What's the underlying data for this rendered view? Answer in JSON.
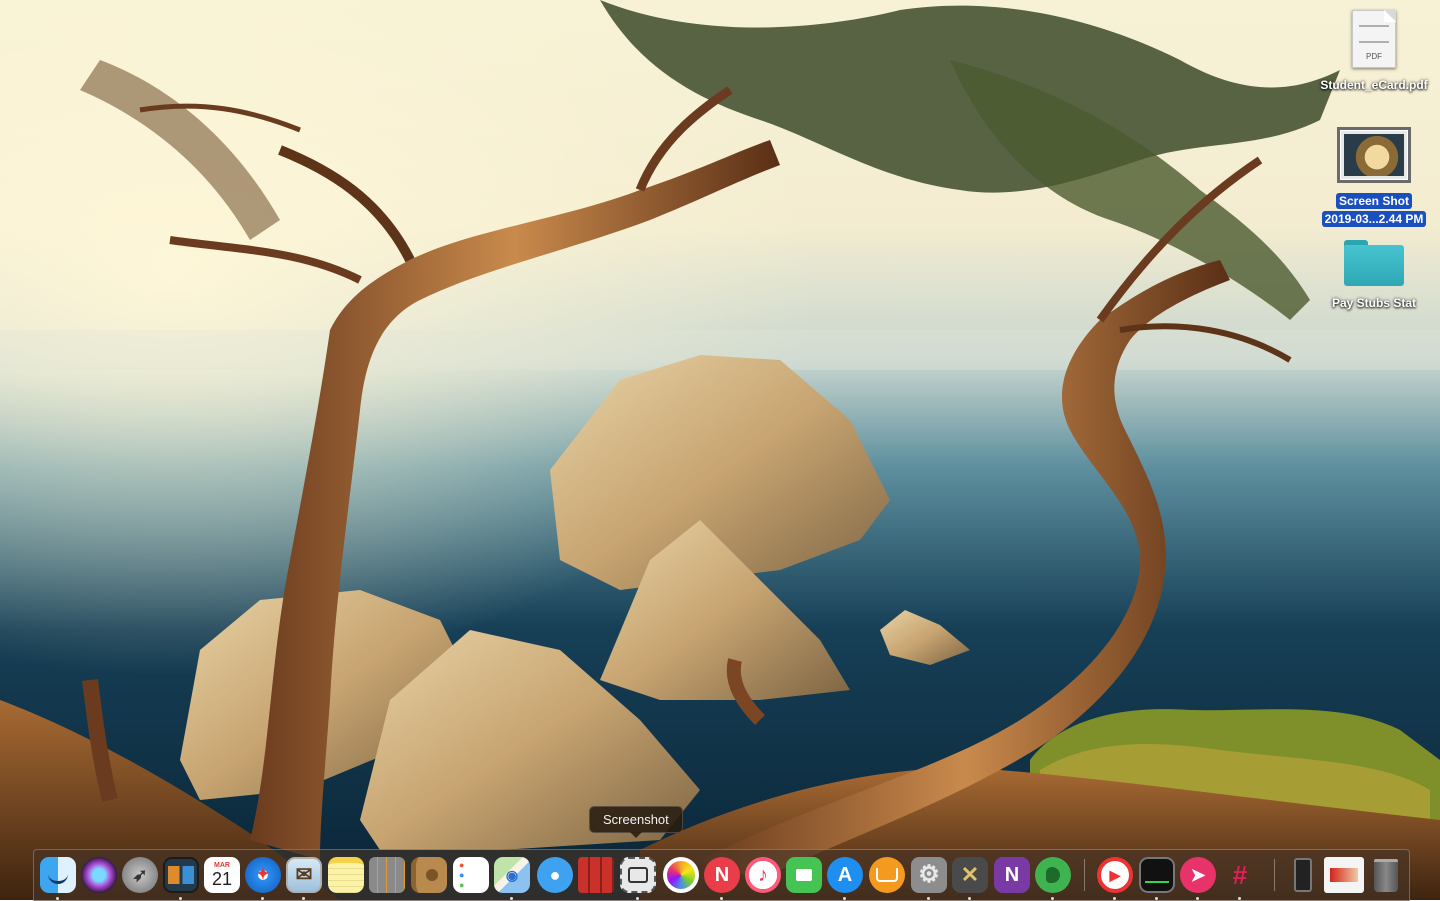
{
  "desktop": {
    "items": [
      {
        "label": "Student_eCard.pdf",
        "icon": "pdf-document-icon",
        "doc_tag": "PDF"
      },
      {
        "label_line1": "Screen Shot",
        "label_line2": "2019-03...2.44 PM",
        "icon": "screenshot-image-icon",
        "selected": true
      },
      {
        "label": "Pay Stubs Stat",
        "icon": "folder-icon"
      }
    ]
  },
  "tooltip": "Screenshot",
  "dock": {
    "apps": [
      {
        "name": "Finder",
        "glyph": ""
      },
      {
        "name": "Siri",
        "glyph": ""
      },
      {
        "name": "Launchpad",
        "glyph": "🚀"
      },
      {
        "name": "Mission Control",
        "glyph": ""
      },
      {
        "name": "Calendar",
        "month": "MAR",
        "day": "21"
      },
      {
        "name": "Safari",
        "glyph": "✦"
      },
      {
        "name": "Mail",
        "glyph": "✉"
      },
      {
        "name": "Notes",
        "glyph": ""
      },
      {
        "name": "Calculator",
        "glyph": ""
      },
      {
        "name": "Contacts",
        "glyph": ""
      },
      {
        "name": "Reminders",
        "glyph": ""
      },
      {
        "name": "Maps",
        "glyph": ""
      },
      {
        "name": "Messages",
        "glyph": "💬"
      },
      {
        "name": "Photo Booth",
        "glyph": ""
      },
      {
        "name": "Screenshot",
        "glyph": "📷"
      },
      {
        "name": "Photos",
        "glyph": ""
      },
      {
        "name": "News",
        "glyph": "N"
      },
      {
        "name": "Music",
        "glyph": "♪"
      },
      {
        "name": "FaceTime",
        "glyph": "▶"
      },
      {
        "name": "App Store",
        "glyph": "A"
      },
      {
        "name": "Books",
        "glyph": "📖"
      },
      {
        "name": "System Preferences",
        "glyph": "⚙"
      },
      {
        "name": "Utilities",
        "glyph": "✕"
      },
      {
        "name": "OneNote",
        "glyph": "N"
      },
      {
        "name": "Evernote",
        "glyph": "🐘"
      },
      {
        "name": "Infuse",
        "glyph": "▶"
      },
      {
        "name": "Activity Monitor",
        "glyph": ""
      },
      {
        "name": "Airmail",
        "glyph": "➤"
      },
      {
        "name": "Slack",
        "glyph": "#"
      },
      {
        "name": "iPhone Backup",
        "glyph": ""
      },
      {
        "name": "Preview",
        "glyph": ""
      },
      {
        "name": "Trash",
        "glyph": ""
      }
    ]
  },
  "colors": {
    "selection": "#1a4fbf",
    "dock_background": "#463426"
  }
}
